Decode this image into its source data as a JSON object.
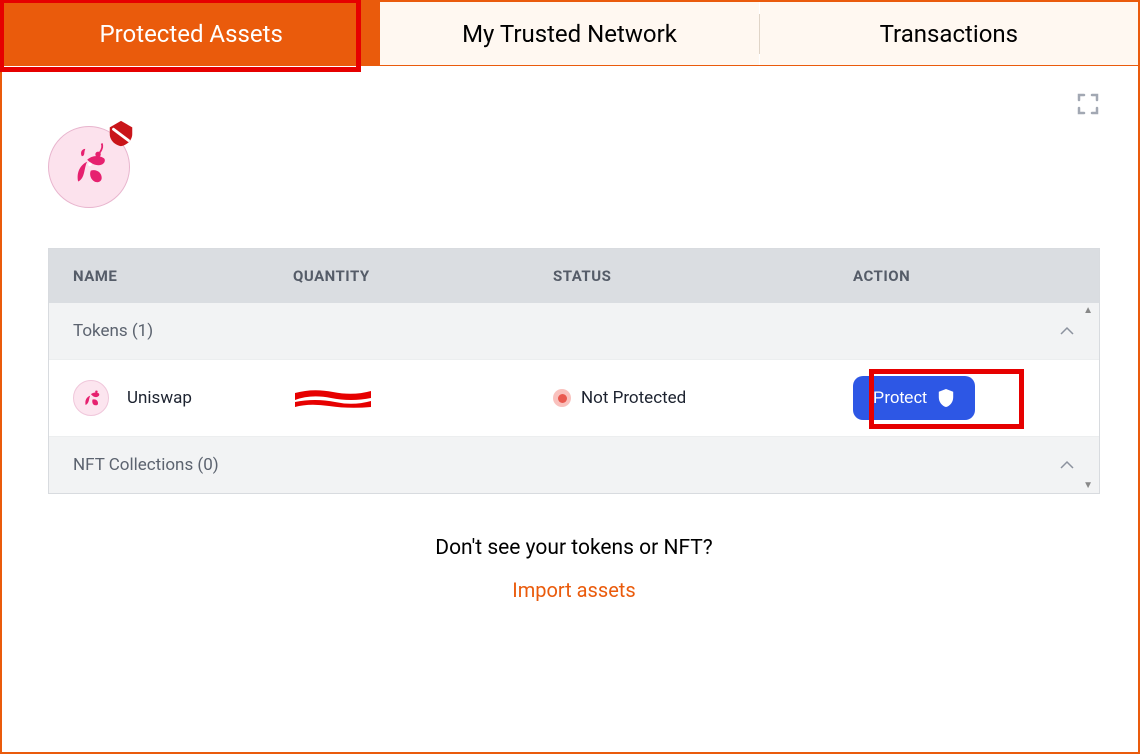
{
  "tabs": {
    "protected_assets": "Protected Assets",
    "trusted_network": "My Trusted Network",
    "transactions": "Transactions"
  },
  "table": {
    "headers": {
      "name": "NAME",
      "quantity": "QUANTITY",
      "status": "STATUS",
      "action": "ACTION"
    },
    "groups": {
      "tokens": {
        "label": "Tokens (1)"
      },
      "nft": {
        "label": "NFT Collections (0)"
      }
    },
    "rows": [
      {
        "name": "Uniswap",
        "status": "Not Protected",
        "action_label": "Protect"
      }
    ]
  },
  "footer": {
    "prompt": "Don't see your tokens or NFT?",
    "link": "Import assets"
  }
}
